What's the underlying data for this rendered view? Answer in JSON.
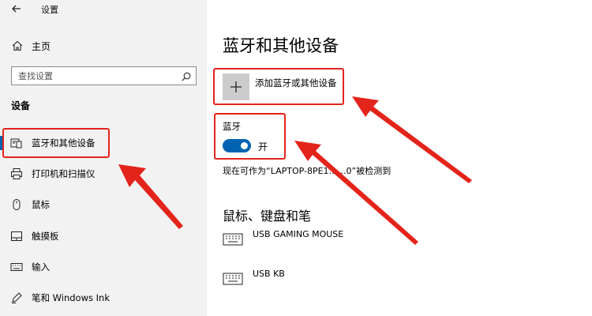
{
  "app": {
    "title": "设置"
  },
  "sidebar": {
    "home_label": "主页",
    "search_placeholder": "查找设置",
    "section_heading": "设备",
    "items": [
      {
        "label": "蓝牙和其他设备",
        "icon": "bluetooth-devices-icon",
        "active": true
      },
      {
        "label": "打印机和扫描仪",
        "icon": "printer-icon"
      },
      {
        "label": "鼠标",
        "icon": "mouse-icon"
      },
      {
        "label": "触摸板",
        "icon": "touchpad-icon"
      },
      {
        "label": "输入",
        "icon": "keyboard-icon"
      },
      {
        "label": "笔和 Windows Ink",
        "icon": "pen-icon"
      }
    ]
  },
  "main": {
    "title": "蓝牙和其他设备",
    "add_device_label": "添加蓝牙或其他设备",
    "bluetooth_label": "蓝牙",
    "bluetooth_state": "开",
    "bluetooth_on": true,
    "discoverable_text": "现在可作为“LAPTOP-8PE1……0”被检测到",
    "section2_title": "鼠标、键盘和笔",
    "devices": [
      {
        "name": "USB GAMING MOUSE",
        "icon": "keyboard-icon"
      },
      {
        "name": "USB KB",
        "icon": "keyboard-icon"
      }
    ]
  },
  "colors": {
    "accent": "#0063b1",
    "highlight": "#e3241b",
    "sidebar_bg": "#f2f2f2"
  }
}
